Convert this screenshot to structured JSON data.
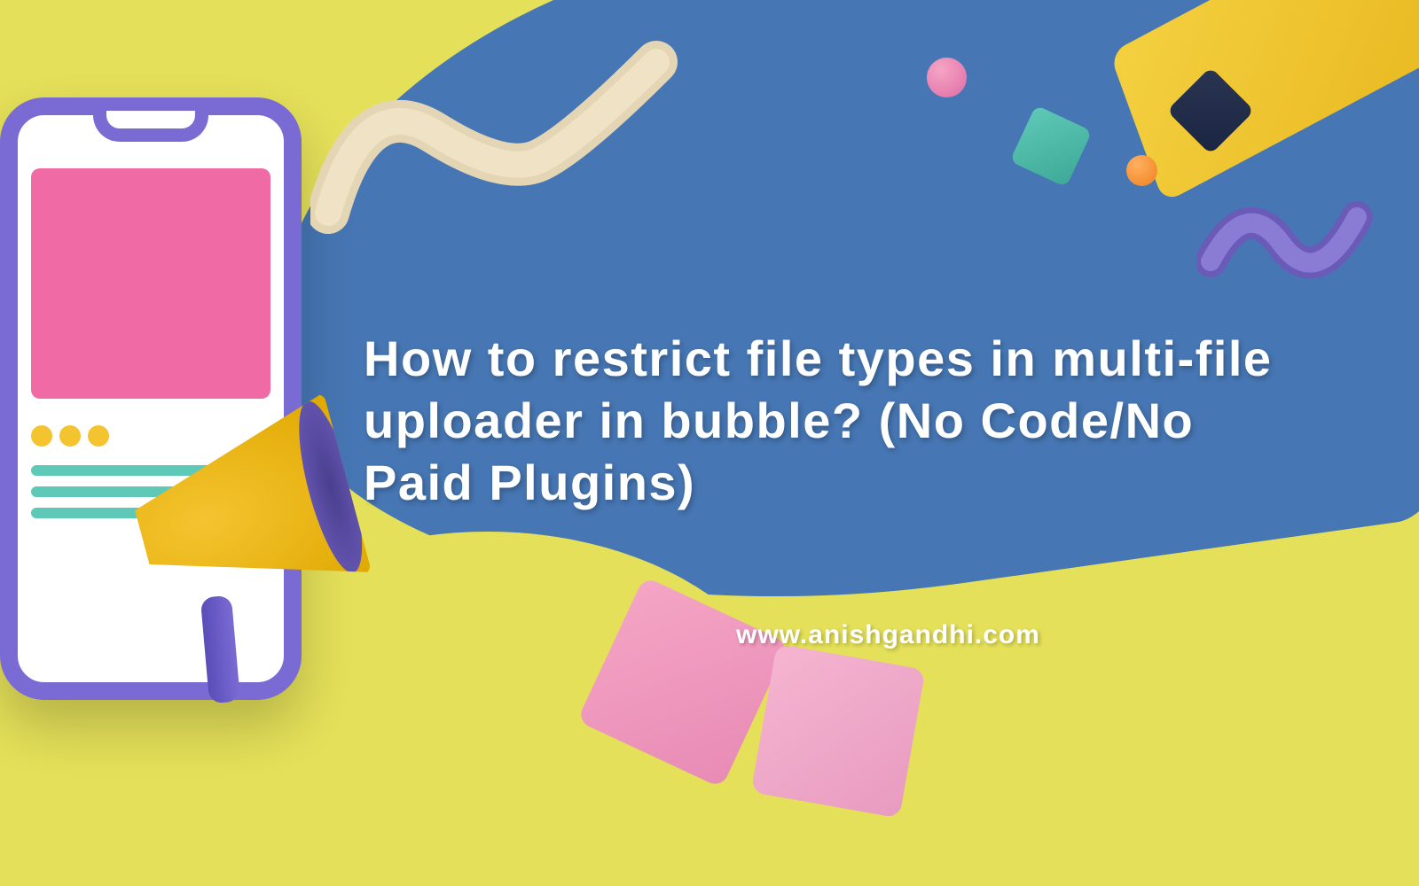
{
  "title": "How to restrict file types in multi-file uploader in bubble? (No Code/No Paid Plugins)",
  "website": "www.anishgandhi.com",
  "colors": {
    "background_yellow": "#e4e059",
    "blue": "#4676b3",
    "purple": "#7a6bd4",
    "pink": "#f06ba5",
    "teal": "#5fc9b8",
    "gold": "#f4c430"
  }
}
